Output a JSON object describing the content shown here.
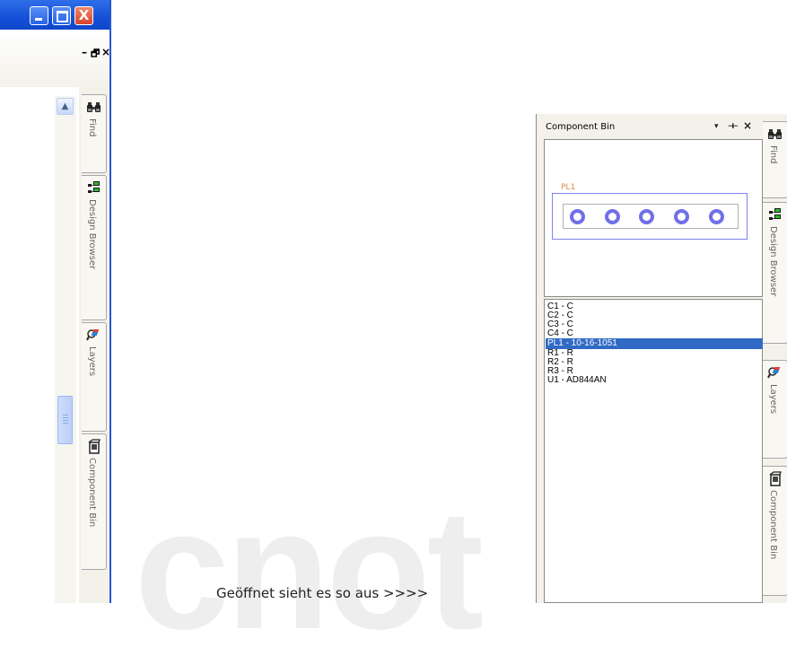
{
  "watermark": "cnot",
  "caption": "Geöffnet sieht es so aus >>>>",
  "left_window": {
    "caption_buttons": {
      "minimize": "",
      "maximize": "",
      "close": "X"
    },
    "mdi_buttons": {
      "minimize": "–",
      "restore": "🗗",
      "close": "×"
    },
    "tabs": [
      {
        "label": "Find",
        "icon": "binoculars-icon"
      },
      {
        "label": "Design Browser",
        "icon": "design-browser-icon"
      },
      {
        "label": "Layers",
        "icon": "layers-icon"
      },
      {
        "label": "Component Bin",
        "icon": "component-bin-icon"
      }
    ]
  },
  "component_bin": {
    "title": "Component Bin",
    "header_buttons": {
      "dropdown": "▾",
      "pin": "⊣⊢",
      "close": "×"
    },
    "preview": {
      "component_label": "PL1",
      "pad_count": 5
    },
    "items": [
      {
        "label": "C1 - C",
        "selected": false
      },
      {
        "label": "C2 - C",
        "selected": false
      },
      {
        "label": "C3 - C",
        "selected": false
      },
      {
        "label": "C4 - C",
        "selected": false
      },
      {
        "label": "PL1 - 10-16-1051",
        "selected": true
      },
      {
        "label": "R1 - R",
        "selected": false
      },
      {
        "label": "R2 - R",
        "selected": false
      },
      {
        "label": "R3 - R",
        "selected": false
      },
      {
        "label": "U1 - AD844AN",
        "selected": false
      }
    ],
    "tabs": [
      {
        "label": "Find",
        "icon": "binoculars-icon"
      },
      {
        "label": "Design Browser",
        "icon": "design-browser-icon"
      },
      {
        "label": "Layers",
        "icon": "layers-icon"
      },
      {
        "label": "Component Bin",
        "icon": "component-bin-icon"
      }
    ]
  },
  "colors": {
    "selection": "#316ac5",
    "title_bar": "#1f5fe0",
    "close_button": "#e0553a",
    "pads": "#7070e8",
    "pl_label": "#e0894a"
  }
}
